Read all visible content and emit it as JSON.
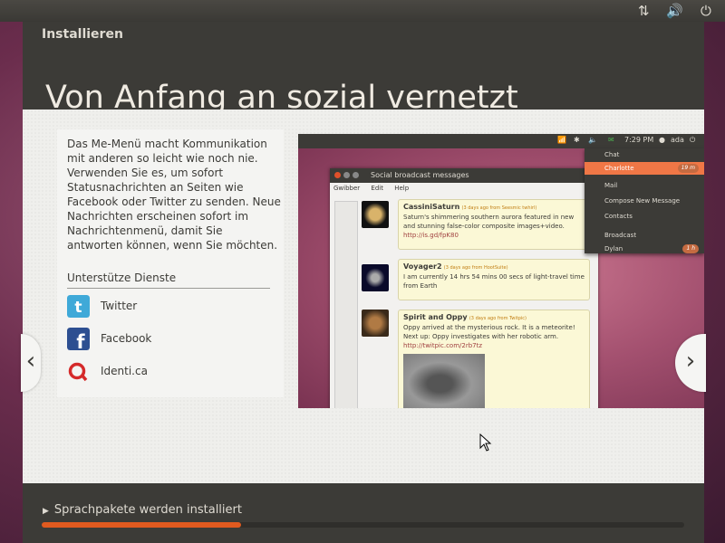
{
  "colors": {
    "accent": "#e05a1f",
    "window_bg": "#3c3b37",
    "slide_bg": "#efefec",
    "menu_highlight": "#f07746"
  },
  "top_panel": {
    "icons": [
      "network-icon",
      "volume-icon",
      "power-icon"
    ]
  },
  "window": {
    "title": "Installieren",
    "headline": "Von Anfang an sozial vernetzt"
  },
  "slide": {
    "description": "Das Me-Menü macht Kommunikation mit anderen so leicht wie noch nie. Verwenden Sie es, um sofort Statusnachrichten an Seiten wie Facebook oder Twitter zu senden. Neue Nachrichten erscheinen sofort im Nachrichtenmenü, damit Sie antworten können, wenn Sie möchten.",
    "services_title": "Unterstütze Dienste",
    "services": [
      {
        "name": "Twitter",
        "icon": "twitter-icon",
        "color": "#3fa9d8"
      },
      {
        "name": "Facebook",
        "icon": "facebook-icon",
        "color": "#2d4f91"
      },
      {
        "name": "Identi.ca",
        "icon": "identica-icon",
        "color": "#d52a2a"
      }
    ],
    "prev_glyph": "‹",
    "next_glyph": "›"
  },
  "screenshot": {
    "panel": {
      "time": "7:29 PM",
      "user": "ada"
    },
    "gwibber": {
      "title": "Social broadcast messages",
      "menu": [
        "Gwibber",
        "Edit",
        "Help"
      ],
      "messages": [
        {
          "author": "CassiniSaturn",
          "source": "(3 days ago from Seesmic twhirl)",
          "text": "Saturn's shimmering southern aurora featured in new and stunning false-color composite images+video.",
          "link": "http://is.gd/fpK80"
        },
        {
          "author": "Voyager2",
          "source": "(3 days ago from HootSuite)",
          "text": "I am currently 14 hrs 54 mins 00 secs of light-travel time from Earth",
          "link": ""
        },
        {
          "author": "Spirit and Oppy",
          "source": "(3 days ago from Twitpic)",
          "text": "Oppy arrived at the mysterious rock. It is a meteorite! Next up: Oppy investigates with her robotic arm.",
          "link": "http://twitpic.com/2rb7tz"
        }
      ]
    },
    "me_menu": {
      "items": [
        {
          "label": "Chat",
          "badge": ""
        },
        {
          "label": "Charlotte",
          "badge": "19 m"
        },
        {
          "label": "Mail",
          "badge": ""
        },
        {
          "label": "Compose New Message",
          "badge": ""
        },
        {
          "label": "Contacts",
          "badge": ""
        },
        {
          "label": "Broadcast",
          "badge": ""
        },
        {
          "label": "Dylan",
          "badge": "1 h"
        }
      ]
    }
  },
  "footer": {
    "status": "Sprachpakete werden installiert",
    "progress": 0.31
  }
}
